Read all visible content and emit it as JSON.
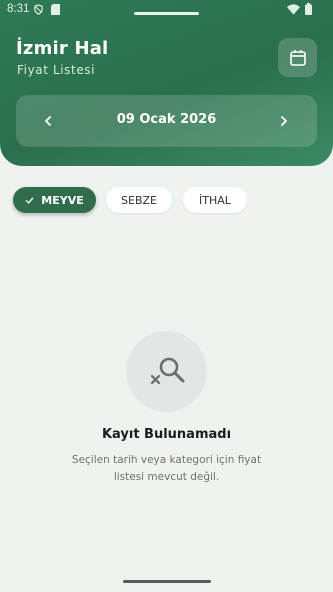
{
  "status_bar": {
    "time": "8:31"
  },
  "header": {
    "title": "İzmir Hal",
    "subtitle": "Fiyat Listesi"
  },
  "date_nav": {
    "date": "09 Ocak 2026"
  },
  "filters": [
    {
      "label": "MEYVE",
      "selected": true
    },
    {
      "label": "SEBZE",
      "selected": false
    },
    {
      "label": "İTHAL",
      "selected": false
    }
  ],
  "empty_state": {
    "title": "Kayıt Bulunamadı",
    "description": "Seçilen tarih veya kategori için fiyat listesi mevcut değil."
  },
  "colors": {
    "primary": "#2f6d4c",
    "header_gradient_start": "#2f7a55",
    "background": "#eff3f0"
  },
  "icons": {
    "calendar": "calendar-icon",
    "prev": "chevron-left-icon",
    "next": "chevron-right-icon",
    "check": "check-icon",
    "empty": "search-off-icon"
  }
}
